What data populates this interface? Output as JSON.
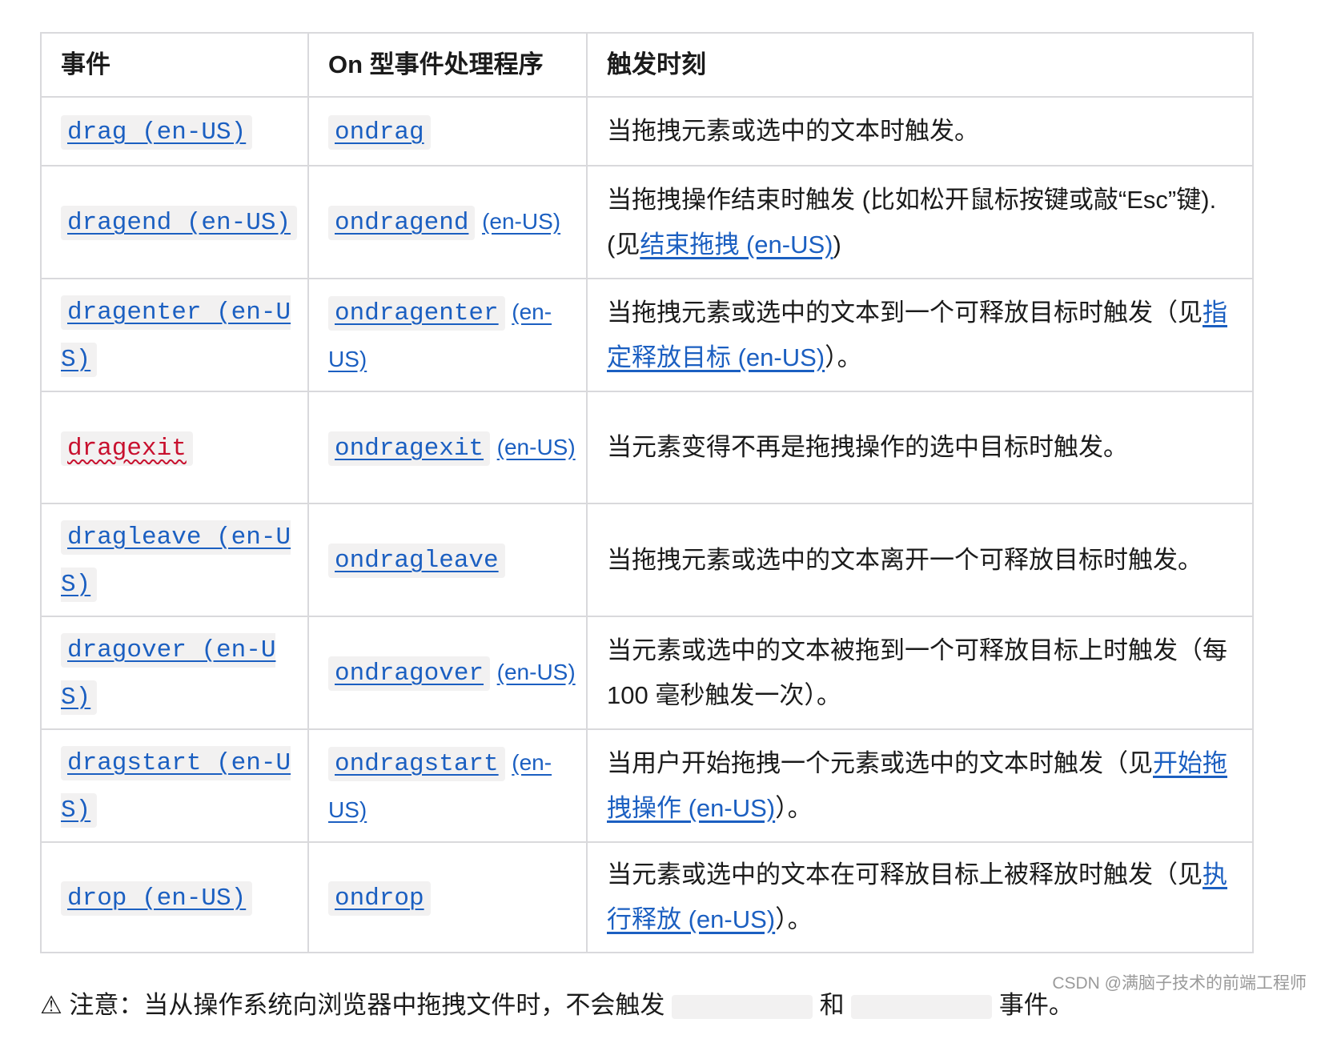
{
  "table": {
    "headers": {
      "event": "事件",
      "handler": "On 型事件处理程序",
      "trigger": "触发时刻"
    },
    "rows": [
      {
        "event": "drag (en-US)",
        "handler": "ondrag",
        "handler_suffix": "",
        "trigger_before": "当拖拽元素或选中的文本时触发。",
        "trigger_link": "",
        "trigger_after": ""
      },
      {
        "event": "dragend (en-US)",
        "handler": "ondragend",
        "handler_suffix": "(en-US)",
        "trigger_before": "当拖拽操作结束时触发 (比如松开鼠标按键或敲“Esc”键). (见",
        "trigger_link": "结束拖拽 (en-US)",
        "trigger_after": ")"
      },
      {
        "event": "dragenter (en-US)",
        "handler": "ondragenter",
        "handler_suffix": "(en-US)",
        "trigger_before": "当拖拽元素或选中的文本到一个可释放目标时触发（见",
        "trigger_link": "指定释放目标 (en-US)",
        "trigger_after": "）。"
      },
      {
        "event": "dragexit",
        "handler": "ondragexit",
        "handler_suffix": "(en-US)",
        "trigger_before": "当元素变得不再是拖拽操作的选中目标时触发。",
        "trigger_link": "",
        "trigger_after": ""
      },
      {
        "event": "dragleave (en-US)",
        "handler": "ondragleave",
        "handler_suffix": "",
        "trigger_before": "当拖拽元素或选中的文本离开一个可释放目标时触发。",
        "trigger_link": "",
        "trigger_after": ""
      },
      {
        "event": "dragover (en-US)",
        "handler": "ondragover",
        "handler_suffix": "(en-US)",
        "trigger_before": "当元素或选中的文本被拖到一个可释放目标上时触发（每 100 毫秒触发一次）。",
        "trigger_link": "",
        "trigger_after": ""
      },
      {
        "event": "dragstart (en-US)",
        "handler": "ondragstart",
        "handler_suffix": "(en-US)",
        "trigger_before": "当用户开始拖拽一个元素或选中的文本时触发（见",
        "trigger_link": "开始拖拽操作 (en-US)",
        "trigger_after": "）。"
      },
      {
        "event": "drop (en-US)",
        "handler": "ondrop",
        "handler_suffix": "",
        "trigger_before": "当元素或选中的文本在可释放目标上被释放时触发（见",
        "trigger_link": "执行释放 (en-US)",
        "trigger_after": "）。"
      }
    ]
  },
  "footer": {
    "cut_text_a": "⚠ 注意：当从操作系统向浏览器中拖拽文件时，不会触发",
    "cut_text_b": "和",
    "cut_text_c": "事件。"
  },
  "watermark": "CSDN @满脑子技术的前端工程师",
  "colors": {
    "link": "#1b5fc1",
    "error": "#c8102e",
    "border": "#d9d9dc",
    "code_bg": "#f2f1f1"
  }
}
